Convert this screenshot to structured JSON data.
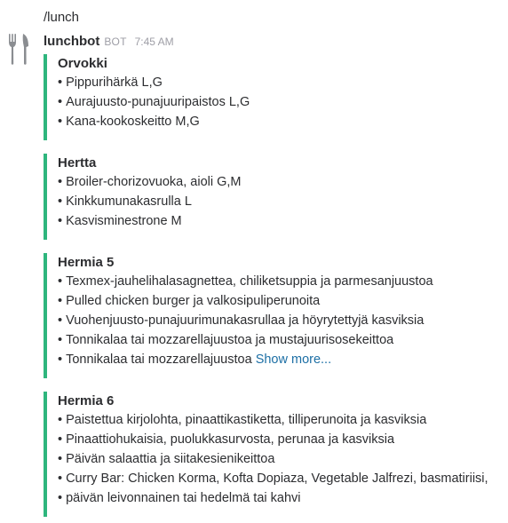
{
  "command": "/lunch",
  "message": {
    "bot_name": "lunchbot",
    "badge": "BOT",
    "timestamp": "7:45 AM",
    "avatar_icon": "fork-and-knife-icon"
  },
  "accent_color": "#2eb67d",
  "link_color": "#1d6fa5",
  "restaurants": [
    {
      "name": "Orvokki",
      "items": [
        "Pippurihärkä  L,G",
        "Aurajuusto-punajuuripaistos  L,G",
        "Kana-kookoskeitto  M,G"
      ]
    },
    {
      "name": "Hertta",
      "items": [
        "Broiler-chorizovuoka, aioli G,M",
        "Kinkkumunakasrulla L",
        "Kasvisminestrone M"
      ]
    },
    {
      "name": "Hermia 5",
      "items": [
        "Texmex-jauhelihalasagnettea, chiliketsuppia ja parmesanjuustoa",
        "Pulled chicken burger ja valkosipuliperunoita",
        "Vuohenjuusto-punajuurimunakasrullaa ja höyrytettyjä kasviksia",
        "Tonnikalaa tai mozzarellajuustoa ja mustajuurisosekeittoa",
        "Tonnikalaa tai mozzarellajuustoa"
      ],
      "show_more": "Show more..."
    },
    {
      "name": "Hermia 6",
      "items": [
        "Paistettua kirjolohta, pinaattikastiketta, tilliperunoita ja kasviksia",
        "Pinaattiohukaisia, puolukkasurvosta, perunaa ja kasviksia",
        "Päivän salaattia ja siitakesienikeittoa",
        "Curry Bar: Chicken Korma, Kofta Dopiaza, Vegetable Jalfrezi, basmatiriisi,",
        "päivän leivonnainen tai hedelmä tai kahvi"
      ]
    }
  ]
}
